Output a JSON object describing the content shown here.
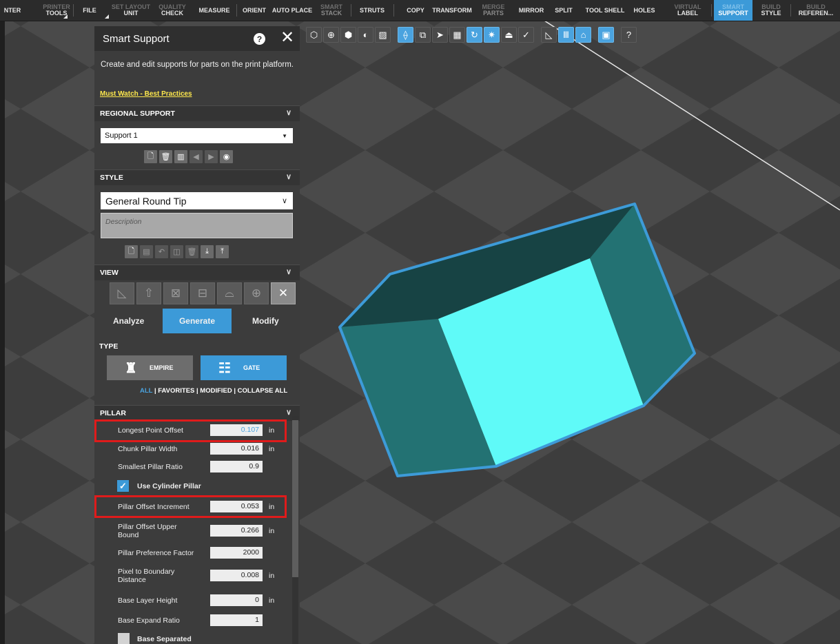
{
  "ribbon": {
    "items": [
      {
        "label": "NTER",
        "sub": ""
      },
      {
        "label": "PRINTER",
        "sub": "TOOLS"
      },
      {
        "label": "FILE",
        "sub": ""
      },
      {
        "label": "SET LAYOUT",
        "sub": "UNIT"
      },
      {
        "label": "QUALITY",
        "sub": "CHECK"
      },
      {
        "label": "MEASURE",
        "sub": ""
      },
      {
        "label": "ORIENT",
        "sub": ""
      },
      {
        "label": "AUTO PLACE",
        "sub": ""
      },
      {
        "label": "SMART",
        "sub": "STACK"
      },
      {
        "label": "STRUTS",
        "sub": ""
      },
      {
        "label": "COPY",
        "sub": ""
      },
      {
        "label": "TRANSFORM",
        "sub": ""
      },
      {
        "label": "MERGE",
        "sub": "PARTS"
      },
      {
        "label": "MIRROR",
        "sub": ""
      },
      {
        "label": "SPLIT",
        "sub": ""
      },
      {
        "label": "TOOL SHELL",
        "sub": ""
      },
      {
        "label": "HOLES",
        "sub": ""
      },
      {
        "label": "VIRTUAL",
        "sub": "LABEL"
      },
      {
        "label": "SMART",
        "sub": "SUPPORT"
      },
      {
        "label": "BUILD",
        "sub": "STYLE"
      },
      {
        "label": "BUILD",
        "sub": "REFEREN..."
      }
    ]
  },
  "toolbar": {
    "icons": [
      "cube-view-icon",
      "zoom-icon",
      "solid-icon",
      "contrast-icon",
      "hatch-icon",
      "support-view-icon",
      "layers-icon",
      "select-arrow-icon",
      "checker-icon",
      "rotate-icon",
      "light-icon",
      "slice-icon",
      "eye-check-icon",
      "stats-icon",
      "pillar-icon",
      "arch-icon",
      "box-icon",
      "help-icon"
    ],
    "glyphs": [
      "⬡",
      "⊕",
      "⬢",
      "◐",
      "▨",
      "⟠",
      "⧉",
      "➤",
      "▦",
      "↻",
      "✷",
      "⏏",
      "✓",
      "◺",
      "Ⅲ",
      "⌂",
      "▣",
      "?"
    ],
    "active": [
      false,
      false,
      false,
      false,
      false,
      true,
      false,
      false,
      false,
      true,
      true,
      false,
      false,
      false,
      true,
      true,
      true,
      false
    ]
  },
  "panel": {
    "title": "Smart Support",
    "description": "Create and edit supports for parts on the print platform.",
    "link": "Must Watch - Best Practices",
    "regional_support": {
      "header": "REGIONAL SUPPORT",
      "selected": "Support 1"
    },
    "style": {
      "header": "STYLE",
      "selected": "General Round Tip",
      "description_placeholder": "Description"
    },
    "view": {
      "header": "VIEW"
    },
    "tabs": [
      {
        "label": "Analyze",
        "active": false
      },
      {
        "label": "Generate",
        "active": true
      },
      {
        "label": "Modify",
        "active": false
      }
    ],
    "type": {
      "header": "TYPE",
      "empire": "EMPIRE",
      "gate": "GATE"
    },
    "filters": {
      "all": "ALL",
      "rest": "| FAVORITES | MODIFIED | COLLAPSE ALL"
    },
    "pillar": {
      "header": "PILLAR",
      "params": [
        {
          "label": "Longest Point Offset",
          "value": "0.107",
          "unit": "in"
        },
        {
          "label": "Chunk Pillar Width",
          "value": "0.016",
          "unit": "in"
        },
        {
          "label": "Smallest Pillar Ratio",
          "value": "0.9",
          "unit": ""
        },
        {
          "label": "Pillar Offset Increment",
          "value": "0.053",
          "unit": "in"
        },
        {
          "label": "Pillar Offset Upper Bound",
          "value": "0.266",
          "unit": "in"
        },
        {
          "label": "Pillar Preference Factor",
          "value": "2000",
          "unit": ""
        },
        {
          "label": "Pixel to Boundary Distance",
          "value": "0.008",
          "unit": "in"
        },
        {
          "label": "Base Layer Height",
          "value": "0",
          "unit": "in"
        },
        {
          "label": "Base Expand Ratio",
          "value": "1",
          "unit": ""
        }
      ],
      "use_cylinder": "Use Cylinder Pillar",
      "base_separated": "Base Separated"
    }
  },
  "colors": {
    "accent": "#3c9ad8",
    "highlight": "#e01b1b",
    "part_face_light": "#5ffaf8",
    "part_face_mid": "#237273",
    "part_face_dark": "#174344",
    "part_outline": "#3d9bd8",
    "link": "#ffe94d"
  }
}
